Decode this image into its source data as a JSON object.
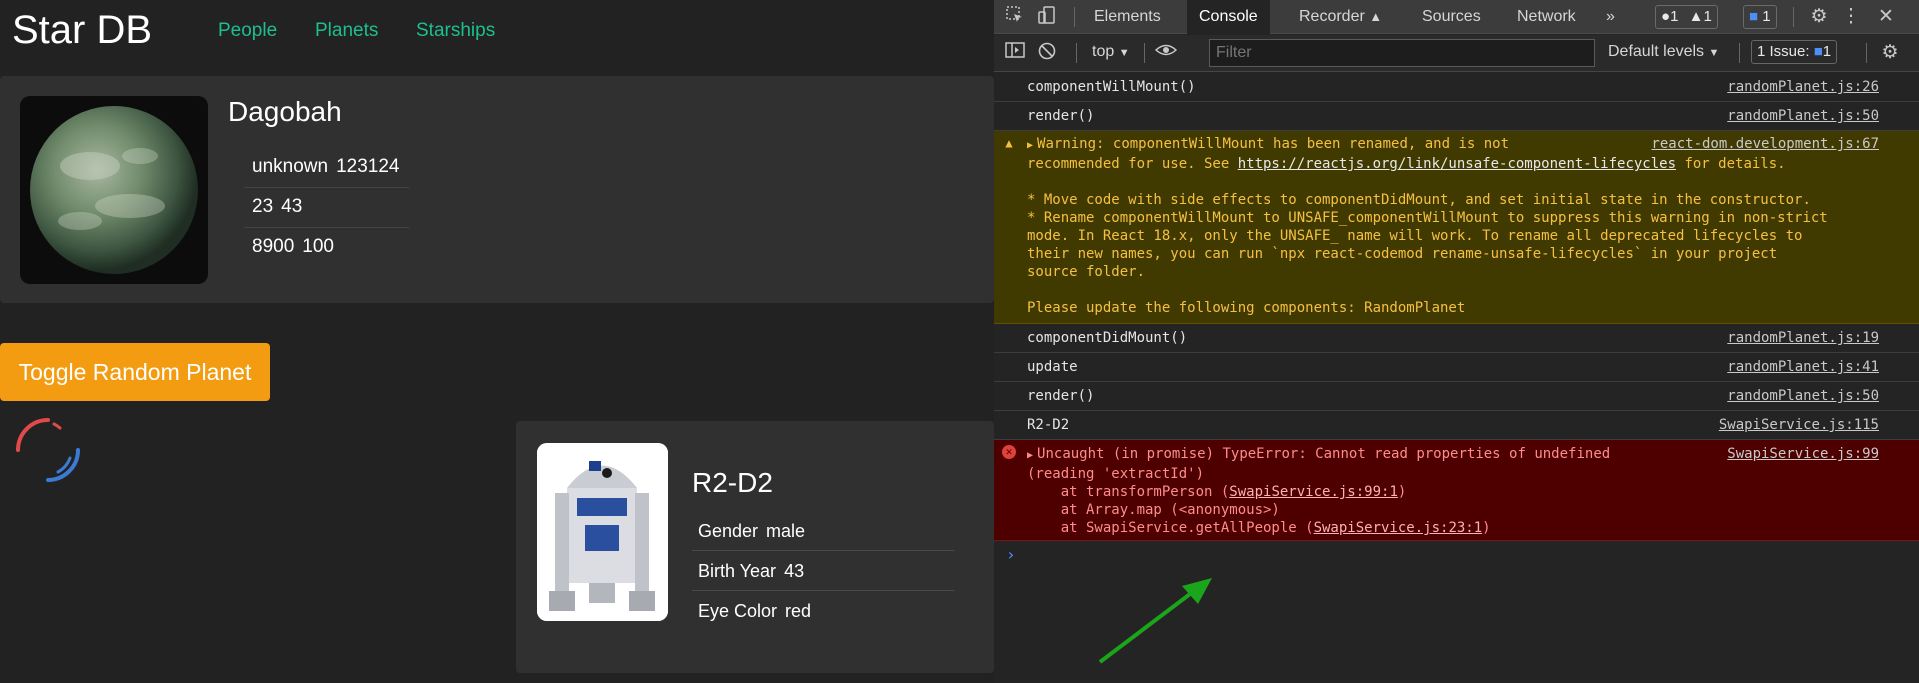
{
  "app": {
    "brand": "Star DB",
    "nav": [
      "People",
      "Planets",
      "Starships"
    ],
    "planet": {
      "name": "Dagobah",
      "rows": [
        [
          "unknown",
          "123124"
        ],
        [
          "23",
          "43"
        ],
        [
          "8900",
          "100"
        ]
      ]
    },
    "toggle_label": "Toggle Random Planet",
    "person": {
      "name": "R2-D2",
      "details": [
        {
          "label": "Gender",
          "value": "male"
        },
        {
          "label": "Birth Year",
          "value": "43"
        },
        {
          "label": "Eye Color",
          "value": "red"
        }
      ]
    }
  },
  "devtools": {
    "tabs": [
      "Elements",
      "Console",
      "Recorder",
      "Sources",
      "Network"
    ],
    "active_tab": "Console",
    "more_tabs": "»",
    "badges": {
      "errors": "1",
      "warnings": "1",
      "messages": "1"
    },
    "toolbar": {
      "context": "top",
      "filter_placeholder": "Filter",
      "levels": "Default levels",
      "issues_label": "1 Issue:",
      "issues_count": "1"
    },
    "messages": [
      {
        "text": "componentWillMount()",
        "source": "randomPlanet.js:26"
      },
      {
        "text": "render()",
        "source": "randomPlanet.js:50"
      },
      {
        "warning_line1": "Warning: componentWillMount has been renamed, and is not",
        "warning_line2_pre": "recommended for use. See ",
        "warning_link": "https://reactjs.org/link/unsafe-component-lifecycles",
        "warning_line2_post": " for details.",
        "warning_body": "* Move code with side effects to componentDidMount, and set initial state in the constructor.\n* Rename componentWillMount to UNSAFE_componentWillMount to suppress this warning in non-strict\nmode. In React 18.x, only the UNSAFE_ name will work. To rename all deprecated lifecycles to\ntheir new names, you can run `npx react-codemod rename-unsafe-lifecycles` in your project\nsource folder.",
        "warning_footer": "Please update the following components: RandomPlanet",
        "source": "react-dom.development.js:67"
      },
      {
        "text": "componentDidMount()",
        "source": "randomPlanet.js:19"
      },
      {
        "text": "update",
        "source": "randomPlanet.js:41"
      },
      {
        "text": "render()",
        "source": "randomPlanet.js:50"
      },
      {
        "text": "R2-D2",
        "source": "SwapiService.js:115"
      },
      {
        "error_line1": "Uncaught (in promise) TypeError: Cannot read properties of undefined",
        "error_line2": "(reading 'extractId')",
        "stack1_pre": "    at transformPerson (",
        "stack1_link": "SwapiService.js:99:1",
        "stack1_post": ")",
        "stack2": "    at Array.map (<anonymous>)",
        "stack3_pre": "    at SwapiService.getAllPeople (",
        "stack3_link": "SwapiService.js:23:1",
        "stack3_post": ")",
        "source": "SwapiService.js:99"
      }
    ],
    "prompt": "›"
  },
  "colors": {
    "accent_nav": "#1dbf8f",
    "button": "#f39c12",
    "arrow": "#1aa51a"
  }
}
